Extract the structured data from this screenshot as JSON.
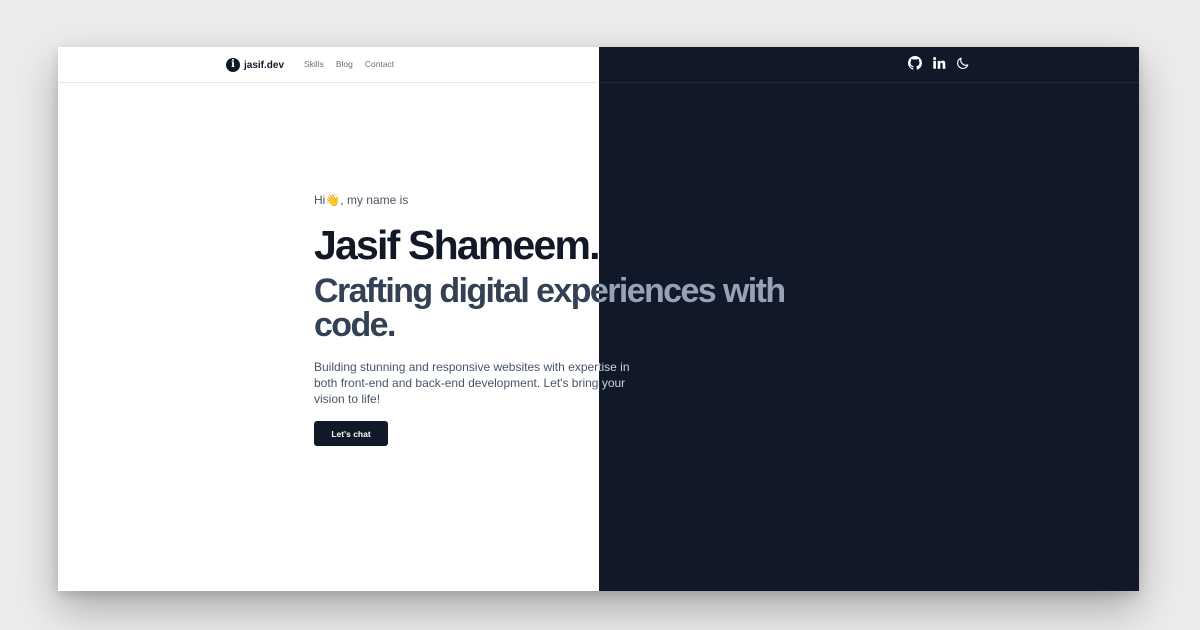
{
  "header": {
    "brand": "jasif.dev",
    "brand_logo": "i",
    "nav": [
      "Skills",
      "Blog",
      "Contact"
    ],
    "icons": [
      "github-icon",
      "linkedin-icon",
      "moon-icon"
    ]
  },
  "hero": {
    "greeting_hi": "Hi",
    "greeting_wave": "👋",
    "greeting_rest": ", my name is",
    "name": "Jasif Shameem.",
    "tagline": "Crafting digital experiences with code.",
    "description": "Building stunning and responsive websites with expertise in both front-end and back-end development. Let's bring your vision to life!",
    "cta_label": "Let's chat"
  },
  "colors": {
    "dark_bg": "#111827",
    "light_bg": "#ffffff",
    "tagline_light": "#334155",
    "tagline_dark": "#94a3b8"
  }
}
